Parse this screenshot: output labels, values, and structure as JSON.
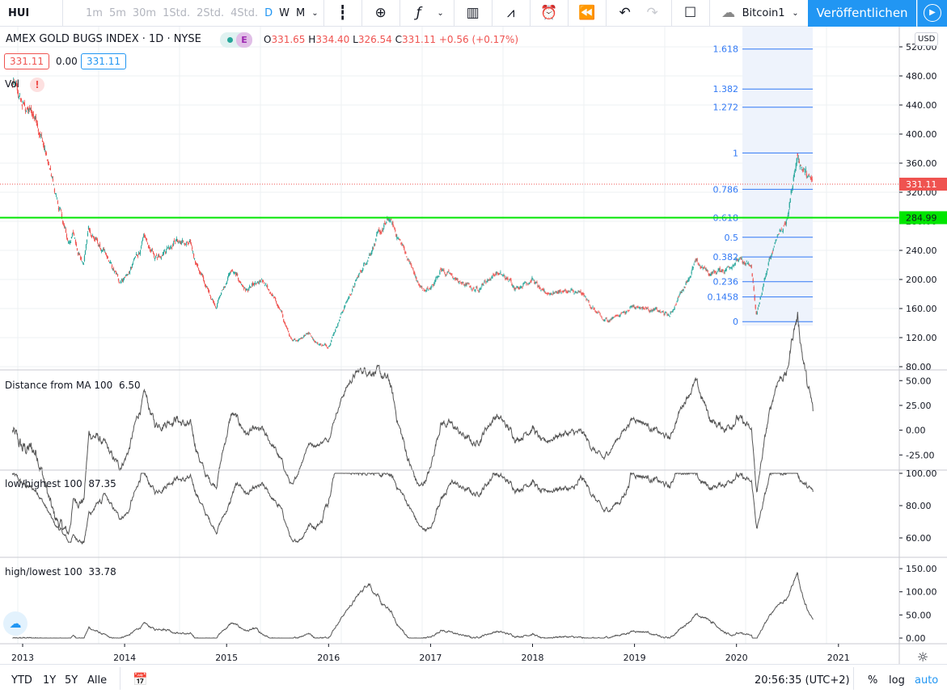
{
  "toolbar": {
    "symbol": "HUI",
    "intervals": [
      "1m",
      "5m",
      "30m",
      "1Std.",
      "2Std.",
      "4Std."
    ],
    "interval_d": "D",
    "interval_w": "W",
    "interval_m": "M",
    "layout_name": "Bitcoin1",
    "publish_label": "Veröffentlichen"
  },
  "legend": {
    "title": "AMEX GOLD BUGS INDEX · 1D · NYSE",
    "e_badge": "E",
    "o_label": "O",
    "o": "331.65",
    "h_label": "H",
    "h": "334.40",
    "l_label": "L",
    "l": "326.54",
    "c_label": "C",
    "c": "331.11",
    "change": "+0.56 (+0.17%)",
    "bid": "331.11",
    "spread": "0.00",
    "ask": "331.11",
    "vol": "Vol",
    "warn": "!"
  },
  "price_axis": {
    "currency": "USD",
    "last_price": "331.11",
    "line_price": "284.99"
  },
  "colors": {
    "up": "#26a69a",
    "down": "#ef5350",
    "accent": "#2196f3",
    "fib": "#3179f5",
    "hline": "#00e600"
  },
  "panes": [
    {
      "label": "Distance from MA 100",
      "value": "6.50"
    },
    {
      "label": "low/highest 100",
      "value": "87.35"
    },
    {
      "label": "high/lowest 100",
      "value": "33.78"
    }
  ],
  "bottom": {
    "ranges": [
      "YTD",
      "1Y",
      "5Y",
      "Alle"
    ],
    "time": "20:56:35 (UTC+2)",
    "pct": "%",
    "log": "log",
    "auto": "auto"
  },
  "chart_data": {
    "type": "candlestick",
    "title": "AMEX GOLD BUGS INDEX · 1D · NYSE",
    "x_ticks": [
      "2013",
      "2014",
      "2015",
      "2016",
      "2017",
      "2018",
      "2019",
      "2020",
      "2021"
    ],
    "y_ticks": [
      80,
      120,
      160,
      200,
      240,
      280,
      320,
      360,
      400,
      440,
      480,
      520
    ],
    "ylim": [
      80,
      520
    ],
    "horizontal_line": 284.99,
    "fib_levels": [
      {
        "level": "0",
        "price": 142
      },
      {
        "level": "0.1458",
        "price": 176
      },
      {
        "level": "0.236",
        "price": 197
      },
      {
        "level": "0.382",
        "price": 231
      },
      {
        "level": "0.5",
        "price": 258
      },
      {
        "level": "0.618",
        "price": 285
      },
      {
        "level": "0.786",
        "price": 324
      },
      {
        "level": "1",
        "price": 374
      },
      {
        "level": "1.272",
        "price": 437
      },
      {
        "level": "1.382",
        "price": 462
      },
      {
        "level": "1.618",
        "price": 517
      }
    ],
    "price_keypoints": [
      [
        2012.9,
        470
      ],
      [
        2013.0,
        440
      ],
      [
        2013.15,
        420
      ],
      [
        2013.3,
        330
      ],
      [
        2013.45,
        250
      ],
      [
        2013.5,
        262
      ],
      [
        2013.6,
        220
      ],
      [
        2013.65,
        270
      ],
      [
        2013.8,
        235
      ],
      [
        2013.95,
        198
      ],
      [
        2014.05,
        210
      ],
      [
        2014.2,
        255
      ],
      [
        2014.3,
        230
      ],
      [
        2014.5,
        255
      ],
      [
        2014.65,
        245
      ],
      [
        2014.8,
        190
      ],
      [
        2014.9,
        165
      ],
      [
        2015.05,
        212
      ],
      [
        2015.2,
        185
      ],
      [
        2015.35,
        195
      ],
      [
        2015.45,
        180
      ],
      [
        2015.55,
        150
      ],
      [
        2015.65,
        112
      ],
      [
        2015.8,
        128
      ],
      [
        2015.9,
        112
      ],
      [
        2016.0,
        108
      ],
      [
        2016.15,
        160
      ],
      [
        2016.3,
        205
      ],
      [
        2016.45,
        250
      ],
      [
        2016.6,
        282
      ],
      [
        2016.75,
        240
      ],
      [
        2016.9,
        188
      ],
      [
        2017.0,
        185
      ],
      [
        2017.1,
        215
      ],
      [
        2017.3,
        195
      ],
      [
        2017.45,
        186
      ],
      [
        2017.65,
        210
      ],
      [
        2017.85,
        190
      ],
      [
        2018.0,
        202
      ],
      [
        2018.1,
        180
      ],
      [
        2018.3,
        185
      ],
      [
        2018.5,
        178
      ],
      [
        2018.6,
        160
      ],
      [
        2018.7,
        142
      ],
      [
        2018.9,
        155
      ],
      [
        2019.0,
        165
      ],
      [
        2019.15,
        160
      ],
      [
        2019.35,
        150
      ],
      [
        2019.45,
        180
      ],
      [
        2019.6,
        222
      ],
      [
        2019.75,
        208
      ],
      [
        2019.9,
        215
      ],
      [
        2020.0,
        228
      ],
      [
        2020.15,
        215
      ],
      [
        2020.2,
        150
      ],
      [
        2020.3,
        210
      ],
      [
        2020.4,
        262
      ],
      [
        2020.5,
        280
      ],
      [
        2020.55,
        330
      ],
      [
        2020.6,
        370
      ],
      [
        2020.7,
        340
      ],
      [
        2020.75,
        331
      ]
    ],
    "indicator_ticks": [
      [
        "50.00",
        "25.00",
        "0.00",
        "-25.00"
      ],
      [
        "100.00",
        "80.00",
        "60.00"
      ],
      [
        "150.00",
        "100.00",
        "50.00",
        "0.00"
      ]
    ]
  }
}
